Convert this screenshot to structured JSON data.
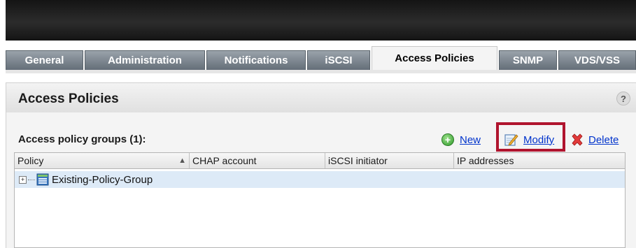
{
  "tabs": [
    {
      "label": "General",
      "active": false
    },
    {
      "label": "Administration",
      "active": false
    },
    {
      "label": "Notifications",
      "active": false
    },
    {
      "label": "iSCSI",
      "active": false
    },
    {
      "label": "Access Policies",
      "active": true
    },
    {
      "label": "SNMP",
      "active": false
    },
    {
      "label": "VDS/VSS",
      "active": false
    }
  ],
  "panel": {
    "title": "Access Policies",
    "help": "?"
  },
  "groups_label": "Access policy groups (1):",
  "actions": {
    "new": "New",
    "modify": "Modify",
    "delete": "Delete"
  },
  "grid": {
    "columns": [
      "Policy",
      "CHAP account",
      "iSCSI initiator",
      "IP addresses"
    ],
    "rows": [
      {
        "policy": "Existing-Policy-Group",
        "chap": "",
        "initiator": "",
        "ip": ""
      }
    ]
  },
  "colors": {
    "highlight_border": "#b0142e",
    "selected_row": "#ddeaf7",
    "link": "#0033cc"
  }
}
